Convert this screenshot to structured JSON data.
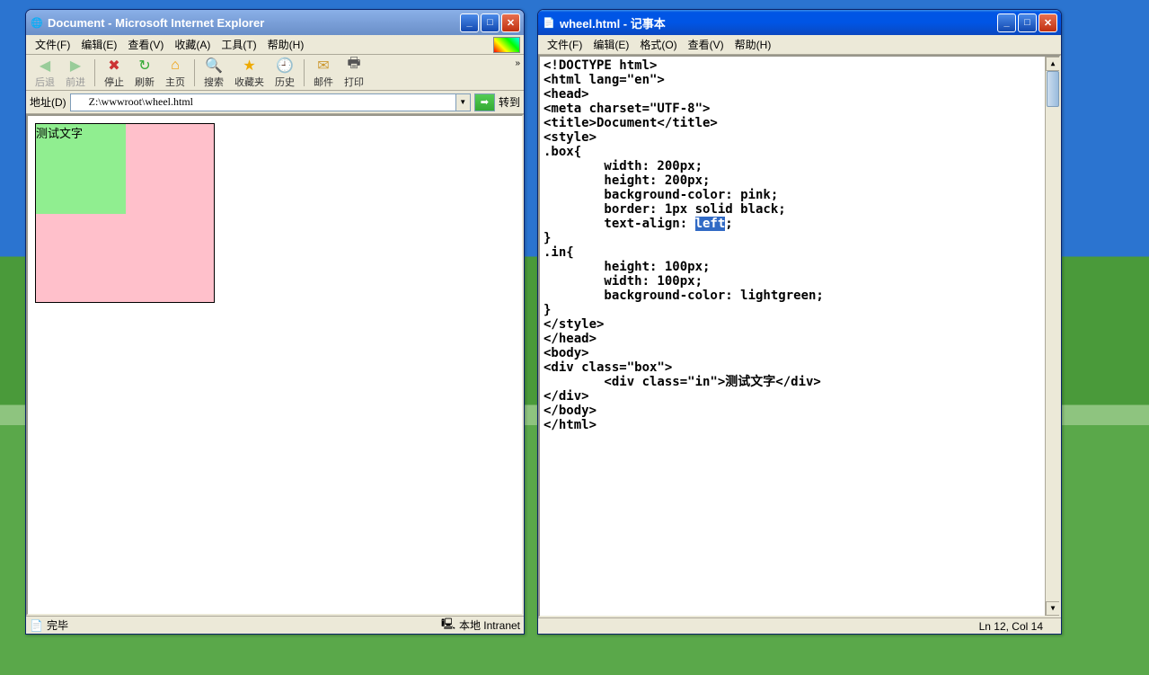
{
  "ie": {
    "title": "Document - Microsoft Internet Explorer",
    "menus": [
      "文件(F)",
      "编辑(E)",
      "查看(V)",
      "收藏(A)",
      "工具(T)",
      "帮助(H)"
    ],
    "toolbar": {
      "back": "后退",
      "forward": "前进",
      "stop": "停止",
      "refresh": "刷新",
      "home": "主页",
      "search": "搜索",
      "favorites": "收藏夹",
      "history": "历史",
      "mail": "邮件",
      "print": "打印"
    },
    "addr_label": "地址(D)",
    "addr_value": "Z:\\wwwroot\\wheel.html",
    "goto": "转到",
    "status_done": "完毕",
    "status_zone": "本地 Intranet",
    "demo_text": "测试文字"
  },
  "np": {
    "title": "wheel.html - 记事本",
    "menus": [
      "文件(F)",
      "编辑(E)",
      "格式(O)",
      "查看(V)",
      "帮助(H)"
    ],
    "status": "Ln 12, Col 14",
    "code_before": "<!DOCTYPE html>\n<html lang=\"en\">\n<head>\n<meta charset=\"UTF-8\">\n<title>Document</title>\n<style>\n.box{\n        width: 200px;\n        height: 200px;\n        background-color: pink;\n        border: 1px solid black;\n        text-align: ",
    "code_hl": "left",
    "code_after": ";\n}\n.in{\n        height: 100px;\n        width: 100px;\n        background-color: lightgreen;\n}\n</style>\n</head>\n<body>\n<div class=\"box\">\n        <div class=\"in\">测试文字</div>\n</div>\n</body>\n</html>"
  }
}
